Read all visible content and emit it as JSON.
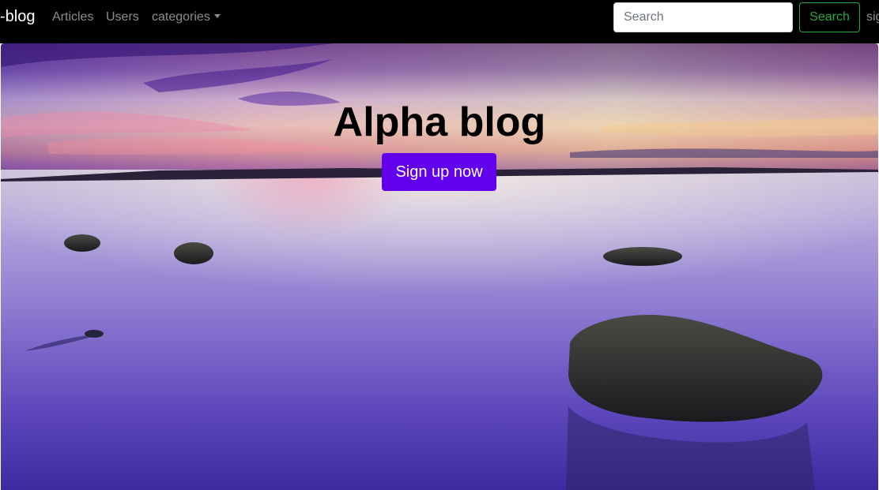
{
  "navbar": {
    "brand": "-blog",
    "links": [
      {
        "label": "Articles"
      },
      {
        "label": "Users"
      },
      {
        "label": "categories"
      }
    ],
    "search": {
      "placeholder": "Search",
      "value": "",
      "button_label": "Search"
    },
    "signup_link": "sign up"
  },
  "hero": {
    "title": "Alpha blog",
    "button_label": "Sign up now"
  },
  "colors": {
    "navbar_bg": "#000000",
    "search_button": "#28a745",
    "primary_button": "#6200ee",
    "title_text": "#000000"
  }
}
